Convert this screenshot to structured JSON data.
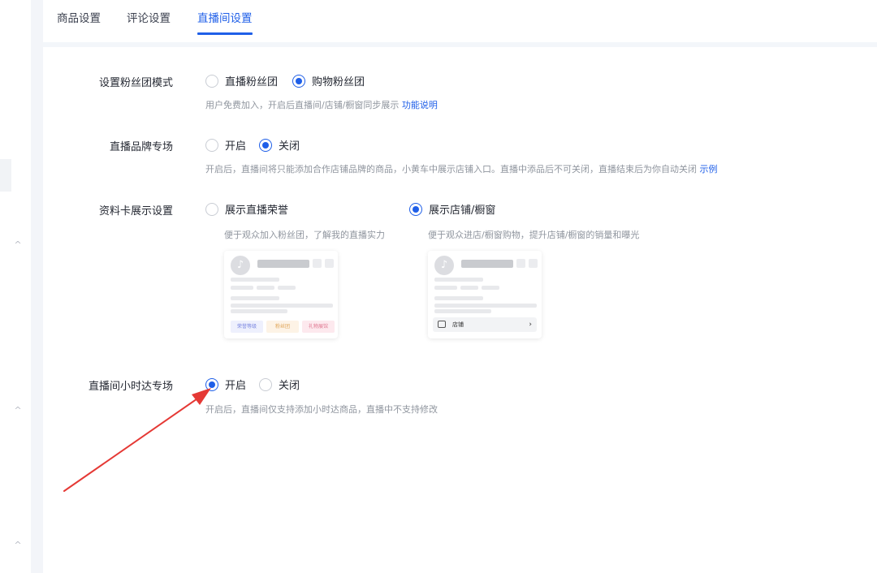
{
  "tabs": [
    {
      "label": "商品设置",
      "active": false
    },
    {
      "label": "评论设置",
      "active": false
    },
    {
      "label": "直播间设置",
      "active": true
    }
  ],
  "fan_group": {
    "label": "设置粉丝团模式",
    "options": [
      "直播粉丝团",
      "购物粉丝团"
    ],
    "selected": "购物粉丝团",
    "hint": "用户免费加入，开启后直播间/店铺/橱窗同步展示",
    "hint_link": "功能说明"
  },
  "brand_zone": {
    "label": "直播品牌专场",
    "options": [
      "开启",
      "关闭"
    ],
    "selected": "关闭",
    "hint": "开启后，直播间将只能添加合作店铺品牌的商品，小黄车中展示店铺入口。直播中添品后不可关闭，直播结束后为你自动关闭",
    "hint_link": "示例"
  },
  "profile_card": {
    "label": "资料卡展示设置",
    "options": [
      {
        "label": "展示直播荣誉",
        "hint": "便于观众加入粉丝团，了解我的直播实力"
      },
      {
        "label": "展示店铺/橱窗",
        "hint": "便于观众进店/橱窗购物，提升店铺/橱窗的销量和曝光"
      }
    ],
    "selected": "展示店铺/橱窗",
    "preview_left_chips": [
      "荣誉等级",
      "粉丝团",
      "礼物展馆"
    ],
    "preview_right_shop": "店铺"
  },
  "hour_delivery": {
    "label": "直播间小时达专场",
    "options": [
      "开启",
      "关闭"
    ],
    "selected": "开启",
    "hint": "开启后，直播间仅支持添加小时达商品，直播中不支持修改"
  },
  "colors": {
    "accent": "#1f5fe8",
    "annotation_arrow": "#e53935"
  },
  "icons": {
    "rail_chevron": "chevron-up-icon",
    "card_avatar": "tiktok-logo-icon",
    "shop_icon": "shop-icon",
    "arrow": "chevron-right-icon"
  },
  "rail_chevrons": [
    "^",
    "^",
    "^"
  ],
  "card_avatar_glyph": "♪",
  "shop_arrow_glyph": "›"
}
